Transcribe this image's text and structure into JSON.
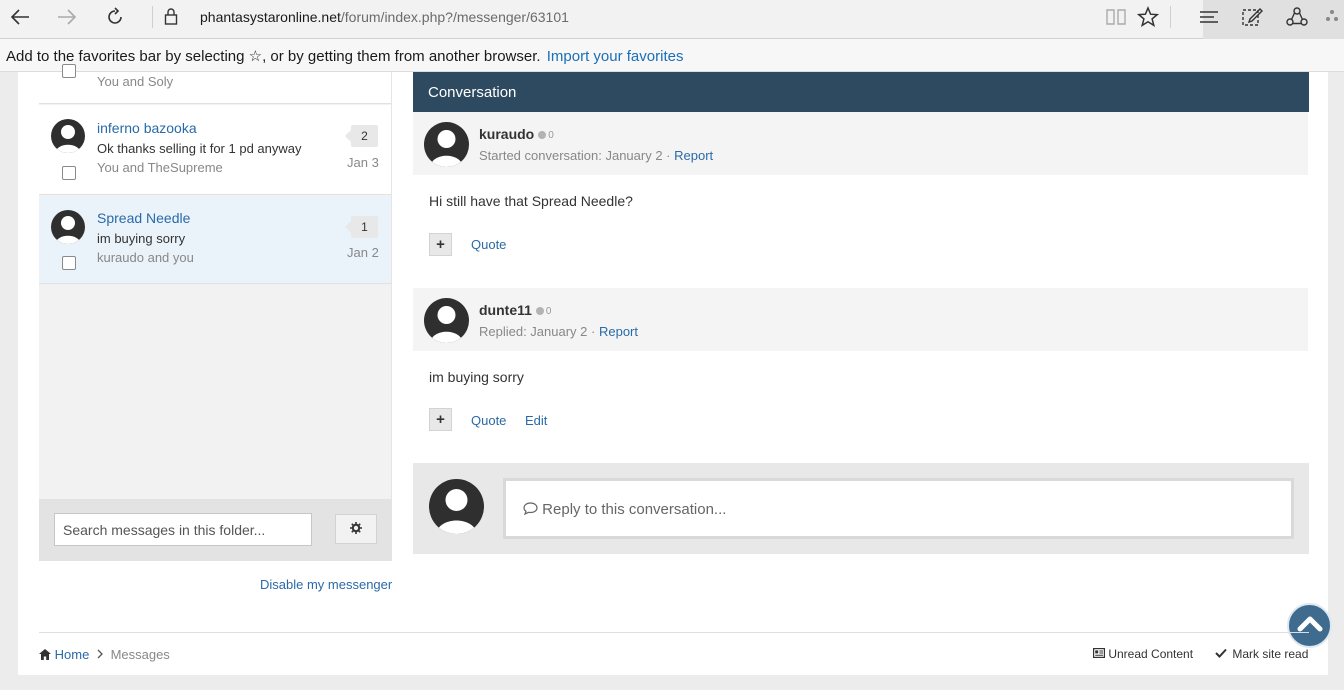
{
  "browser": {
    "url_host": "phantasystaronline.net",
    "url_path": "/forum/index.php?/messenger/63101"
  },
  "favorites_bar": {
    "text": "Add to the favorites bar by selecting ☆, or by getting them from another browser.",
    "link": "Import your favorites"
  },
  "messages": [
    {
      "title": "",
      "snippet": "",
      "participants": "You and Soly",
      "count": "",
      "date": ""
    },
    {
      "title": "inferno bazooka",
      "snippet": "Ok thanks selling it for 1 pd anyway",
      "participants": "You and TheSupreme",
      "count": "2",
      "date": "Jan 3"
    },
    {
      "title": "Spread Needle",
      "snippet": "im buying sorry",
      "participants": "kuraudo and you",
      "count": "1",
      "date": "Jan 2"
    }
  ],
  "search": {
    "placeholder": "Search messages in this folder..."
  },
  "disable_link": "Disable my messenger",
  "conversation": {
    "header": "Conversation",
    "posts": [
      {
        "author": "kuraudo",
        "rep": "0",
        "meta": "Started conversation: January 2 ·",
        "report": "Report",
        "body": "Hi still have that Spread Needle?",
        "actions": [
          "Quote"
        ]
      },
      {
        "author": "dunte11",
        "rep": "0",
        "meta": "Replied: January 2 ·",
        "report": "Report",
        "body": "im buying sorry",
        "actions": [
          "Quote",
          "Edit"
        ]
      }
    ],
    "reply_placeholder": "Reply to this conversation..."
  },
  "footer": {
    "home": "Home",
    "current": "Messages",
    "unread": "Unread Content",
    "mark_read": "Mark site read"
  }
}
